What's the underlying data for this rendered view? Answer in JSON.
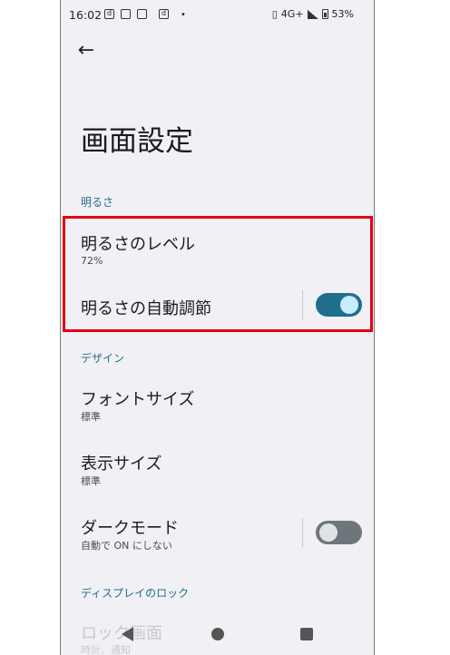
{
  "status_bar": {
    "time": "16:02",
    "network": "4G+",
    "battery": "53%",
    "dot": "•"
  },
  "header": {
    "back_icon": "arrow-left-icon",
    "title": "画面設定"
  },
  "sections": {
    "brightness": {
      "label": "明るさ",
      "level_title": "明るさのレベル",
      "level_value": "72%",
      "auto_title": "明るさの自動調節",
      "auto_on": true
    },
    "design": {
      "label": "デザイン",
      "font_title": "フォントサイズ",
      "font_value": "標準",
      "display_title": "表示サイズ",
      "display_value": "標準",
      "dark_title": "ダークモード",
      "dark_sub": "自動で ON にしない",
      "dark_on": false
    },
    "lock": {
      "label": "ディスプレイのロック",
      "lock_title": "ロック画面",
      "lock_sub": "時計、通知"
    }
  },
  "colors": {
    "accent": "#1e6e8c",
    "highlight": "#e60012",
    "background": "#f1f0f5"
  }
}
